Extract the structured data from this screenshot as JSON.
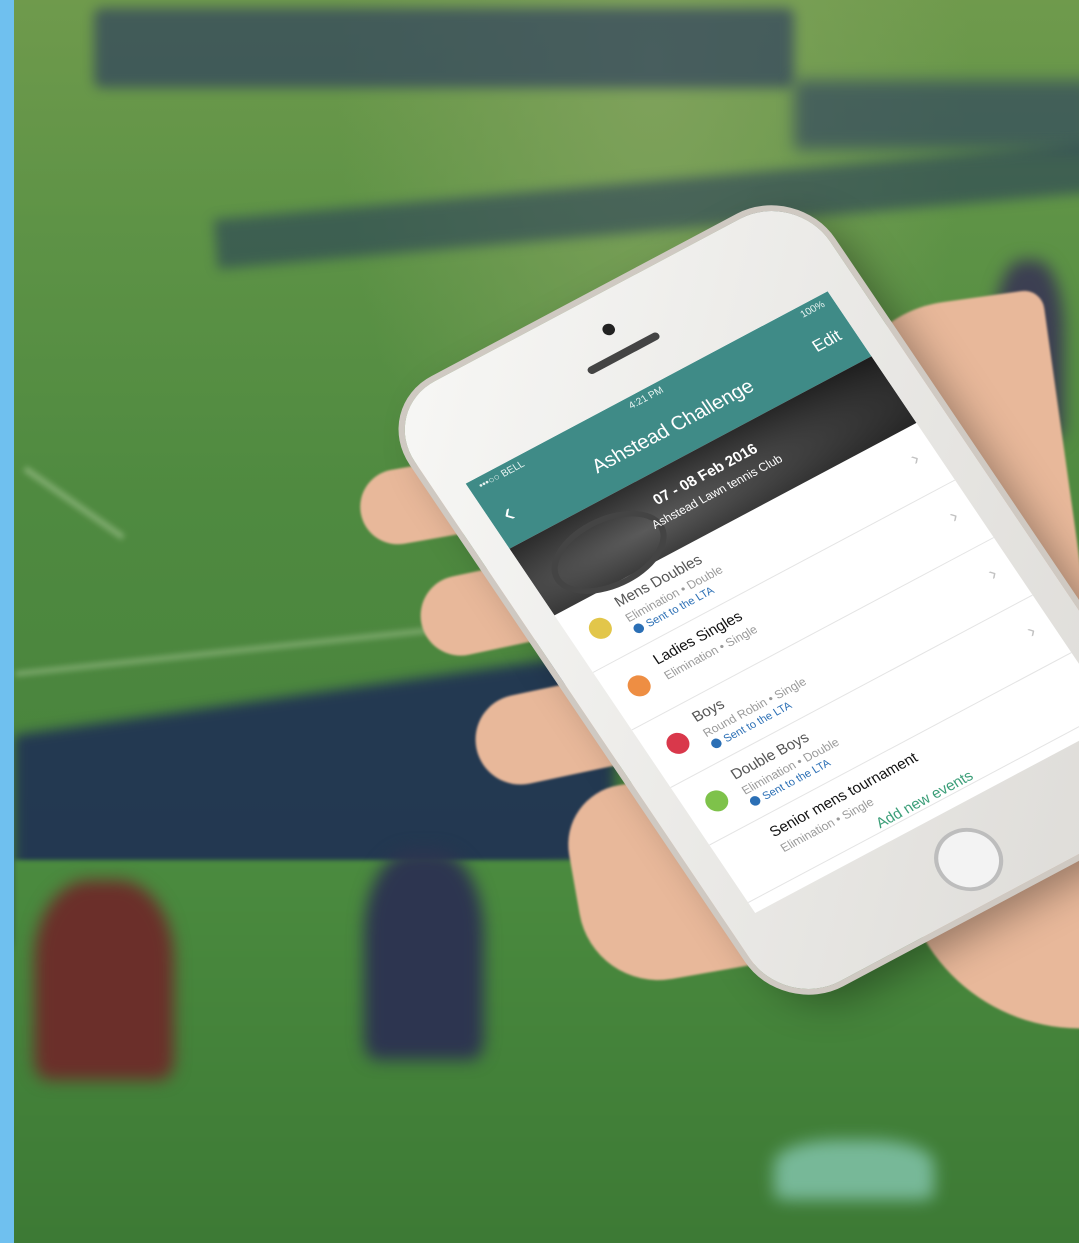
{
  "status_bar": {
    "carrier": "•••○○ BELL",
    "time": "4:21 PM",
    "battery": "100%"
  },
  "nav": {
    "back_icon": "chevron-left-icon",
    "title": "Ashstead Challenge",
    "edit_label": "Edit"
  },
  "hero": {
    "dates": "07 - 08 Feb 2016",
    "club": "Ashstead Lawn tennis Club"
  },
  "events": [
    {
      "title": "Mens Doubles",
      "subtitle": "Elimination • Double",
      "sent": "Sent to the LTA",
      "dot_color": "#e2c64a",
      "strong": false
    },
    {
      "title": "Ladies Singles",
      "subtitle": "Elimination • Single",
      "sent": "",
      "dot_color": "#ee8e43",
      "strong": true
    },
    {
      "title": "Boys",
      "subtitle": "Round Robin • Single",
      "sent": "Sent to the LTA",
      "dot_color": "#d9384b",
      "strong": false
    },
    {
      "title": "Double Boys",
      "subtitle": "Elimination • Double",
      "sent": "Sent to the LTA",
      "dot_color": "#7ec24a",
      "strong": false
    },
    {
      "title": "Senior mens tournament",
      "subtitle": "Elimination • Single",
      "sent": "",
      "dot_color": "",
      "strong": true
    }
  ],
  "add_events_label": "Add new events",
  "colors": {
    "nav_bg": "#3f8b87",
    "link": "#3b9e78",
    "sent": "#2b6fb5",
    "accent_strip": "#6fc0ef"
  }
}
